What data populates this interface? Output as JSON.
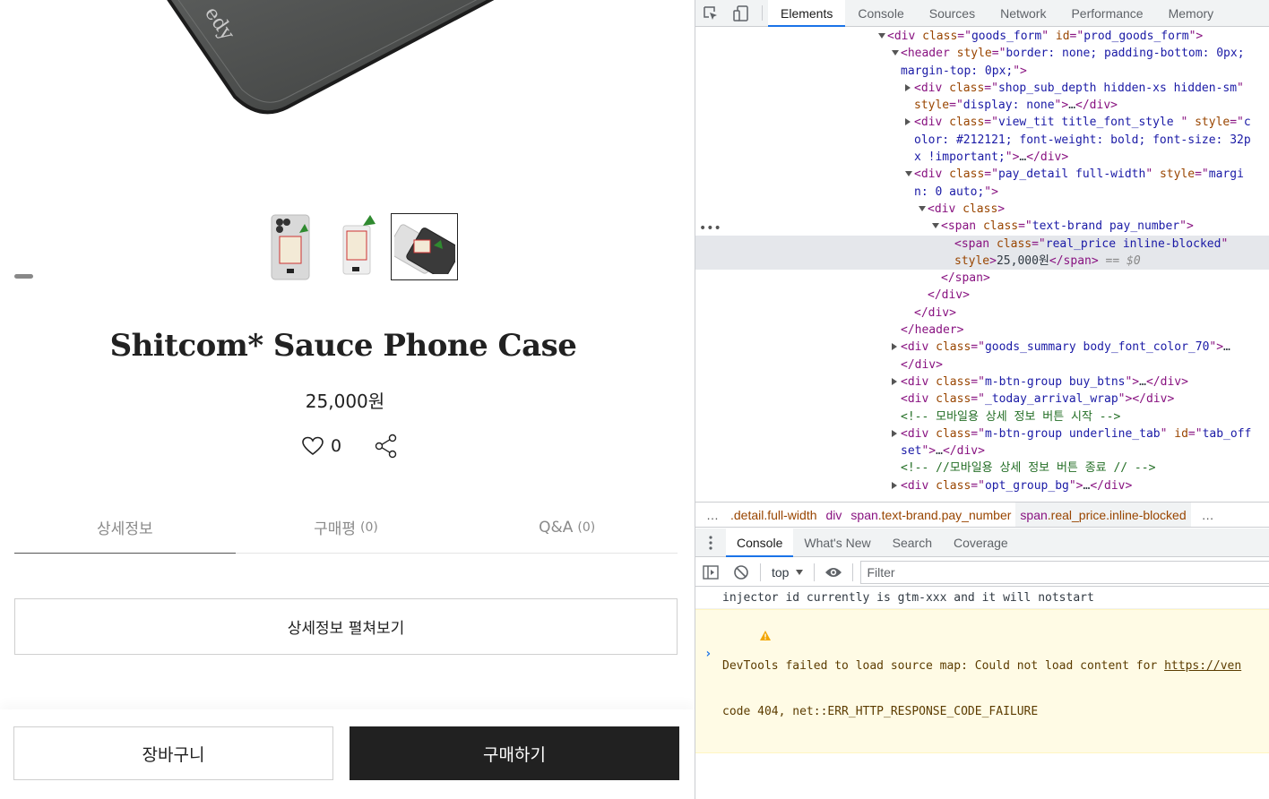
{
  "shop": {
    "hero_text": "edy",
    "thumbnails": [
      {
        "name": "thumb-case-front",
        "active": false
      },
      {
        "name": "thumb-case-back",
        "active": false
      },
      {
        "name": "thumb-case-pair",
        "active": true
      }
    ],
    "product_title": "Shitcom* Sauce Phone Case",
    "price": "25,000원",
    "like_count": "0",
    "tabs": [
      {
        "label": "상세정보",
        "count": ""
      },
      {
        "label": "구매평",
        "count": "(0)"
      },
      {
        "label": "Q&A",
        "count": "(0)"
      }
    ],
    "expand_label": "상세정보 펼쳐보기",
    "cart_label": "장바구니",
    "buy_label": "구매하기"
  },
  "devtools": {
    "tabs": [
      "Elements",
      "Console",
      "Sources",
      "Network",
      "Performance",
      "Memory"
    ],
    "active_tab": "Elements",
    "dom_lines": [
      {
        "indent": 0,
        "tw": "open",
        "parts": [
          [
            "tag",
            "<div "
          ],
          [
            "attr",
            "class"
          ],
          [
            "tag",
            "=\""
          ],
          [
            "val",
            "goods_form"
          ],
          [
            "tag",
            "\" "
          ],
          [
            "attr",
            "id"
          ],
          [
            "tag",
            "=\""
          ],
          [
            "val",
            "prod_goods_form"
          ],
          [
            "tag",
            "\">"
          ]
        ]
      },
      {
        "indent": 1,
        "tw": "open",
        "parts": [
          [
            "tag",
            "<header "
          ],
          [
            "attr",
            "style"
          ],
          [
            "tag",
            "=\""
          ],
          [
            "val",
            "border: none; padding-bottom: 0px;"
          ]
        ]
      },
      {
        "indent": 1,
        "tw": "",
        "parts": [
          [
            "val",
            "margin-top: 0px;"
          ],
          [
            "tag",
            "\">"
          ]
        ]
      },
      {
        "indent": 2,
        "tw": "closed",
        "parts": [
          [
            "tag",
            "<div "
          ],
          [
            "attr",
            "class"
          ],
          [
            "tag",
            "=\""
          ],
          [
            "val",
            "shop_sub_depth hidden-xs hidden-sm"
          ],
          [
            "tag",
            "\""
          ]
        ]
      },
      {
        "indent": 2,
        "tw": "",
        "parts": [
          [
            "attr",
            "style"
          ],
          [
            "tag",
            "=\""
          ],
          [
            "val",
            "display: none"
          ],
          [
            "tag",
            "\">"
          ],
          [
            "txt",
            "…"
          ],
          [
            "tag",
            "</div>"
          ]
        ]
      },
      {
        "indent": 2,
        "tw": "closed",
        "parts": [
          [
            "tag",
            "<div "
          ],
          [
            "attr",
            "class"
          ],
          [
            "tag",
            "=\""
          ],
          [
            "val",
            "view_tit title_font_style "
          ],
          [
            "tag",
            "\" "
          ],
          [
            "attr",
            "style"
          ],
          [
            "tag",
            "=\""
          ],
          [
            "val",
            "c"
          ]
        ]
      },
      {
        "indent": 2,
        "tw": "",
        "parts": [
          [
            "val",
            "olor: #212121; font-weight: bold; font-size: 32p"
          ]
        ]
      },
      {
        "indent": 2,
        "tw": "",
        "parts": [
          [
            "val",
            "x !important;"
          ],
          [
            "tag",
            "\">"
          ],
          [
            "txt",
            "…"
          ],
          [
            "tag",
            "</div>"
          ]
        ]
      },
      {
        "indent": 2,
        "tw": "open",
        "parts": [
          [
            "tag",
            "<div "
          ],
          [
            "attr",
            "class"
          ],
          [
            "tag",
            "=\""
          ],
          [
            "val",
            "pay_detail full-width"
          ],
          [
            "tag",
            "\" "
          ],
          [
            "attr",
            "style"
          ],
          [
            "tag",
            "=\""
          ],
          [
            "val",
            "margi"
          ]
        ]
      },
      {
        "indent": 2,
        "tw": "",
        "parts": [
          [
            "val",
            "n: 0 auto;"
          ],
          [
            "tag",
            "\">"
          ]
        ]
      },
      {
        "indent": 3,
        "tw": "open",
        "parts": [
          [
            "tag",
            "<div "
          ],
          [
            "attr",
            "class"
          ],
          [
            "tag",
            ">"
          ]
        ]
      },
      {
        "indent": 4,
        "tw": "open",
        "parts": [
          [
            "tag",
            "<span "
          ],
          [
            "attr",
            "class"
          ],
          [
            "tag",
            "=\""
          ],
          [
            "val",
            "text-brand pay_number"
          ],
          [
            "tag",
            "\">"
          ]
        ]
      },
      {
        "indent": 5,
        "tw": "",
        "sel": true,
        "parts": [
          [
            "tag",
            "<span "
          ],
          [
            "attr",
            "class"
          ],
          [
            "tag",
            "=\""
          ],
          [
            "val",
            "real_price inline-blocked"
          ],
          [
            "tag",
            "\""
          ]
        ]
      },
      {
        "indent": 5,
        "tw": "",
        "sel": true,
        "parts": [
          [
            "attr",
            "style"
          ],
          [
            "tag",
            ">"
          ],
          [
            "txt",
            "25,000원"
          ],
          [
            "tag",
            "</span>"
          ],
          [
            "dim",
            " == $0"
          ]
        ]
      },
      {
        "indent": 4,
        "tw": "",
        "parts": [
          [
            "tag",
            "</span>"
          ]
        ]
      },
      {
        "indent": 3,
        "tw": "",
        "parts": [
          [
            "tag",
            "</div>"
          ]
        ]
      },
      {
        "indent": 2,
        "tw": "",
        "parts": [
          [
            "tag",
            "</div>"
          ]
        ]
      },
      {
        "indent": 1,
        "tw": "",
        "parts": [
          [
            "tag",
            "</header>"
          ]
        ]
      },
      {
        "indent": 1,
        "tw": "closed",
        "parts": [
          [
            "tag",
            "<div "
          ],
          [
            "attr",
            "class"
          ],
          [
            "tag",
            "=\""
          ],
          [
            "val",
            "goods_summary body_font_color_70"
          ],
          [
            "tag",
            "\">"
          ],
          [
            "txt",
            "…"
          ]
        ]
      },
      {
        "indent": 1,
        "tw": "",
        "parts": [
          [
            "tag",
            "</div>"
          ]
        ]
      },
      {
        "indent": 1,
        "tw": "closed",
        "parts": [
          [
            "tag",
            "<div "
          ],
          [
            "attr",
            "class"
          ],
          [
            "tag",
            "=\""
          ],
          [
            "val",
            "m-btn-group buy_btns"
          ],
          [
            "tag",
            "\">"
          ],
          [
            "txt",
            "…"
          ],
          [
            "tag",
            "</div>"
          ]
        ]
      },
      {
        "indent": 1,
        "tw": "",
        "parts": [
          [
            "tag",
            "<div "
          ],
          [
            "attr",
            "class"
          ],
          [
            "tag",
            "=\""
          ],
          [
            "val",
            "_today_arrival_wrap"
          ],
          [
            "tag",
            "\">"
          ],
          [
            "tag",
            "</div>"
          ]
        ]
      },
      {
        "indent": 1,
        "tw": "",
        "parts": [
          [
            "cmt",
            "<!-- 모바일용 상세 정보 버튼 시작 -->"
          ]
        ]
      },
      {
        "indent": 1,
        "tw": "closed",
        "parts": [
          [
            "tag",
            "<div "
          ],
          [
            "attr",
            "class"
          ],
          [
            "tag",
            "=\""
          ],
          [
            "val",
            "m-btn-group underline_tab"
          ],
          [
            "tag",
            "\" "
          ],
          [
            "attr",
            "id"
          ],
          [
            "tag",
            "=\""
          ],
          [
            "val",
            "tab_off"
          ]
        ]
      },
      {
        "indent": 1,
        "tw": "",
        "parts": [
          [
            "val",
            "set"
          ],
          [
            "tag",
            "\">"
          ],
          [
            "txt",
            "…"
          ],
          [
            "tag",
            "</div>"
          ]
        ]
      },
      {
        "indent": 1,
        "tw": "",
        "parts": [
          [
            "cmt",
            "<!-- //모바일용 상세 정보 버튼 종료 // -->"
          ]
        ]
      },
      {
        "indent": 1,
        "tw": "closed",
        "parts": [
          [
            "tag",
            "<div "
          ],
          [
            "attr",
            "class"
          ],
          [
            "tag",
            "=\""
          ],
          [
            "val",
            "opt_group_bg"
          ],
          [
            "tag",
            "\">"
          ],
          [
            "txt",
            "…"
          ],
          [
            "tag",
            "</div>"
          ]
        ]
      }
    ],
    "breadcrumbs": [
      {
        "el": "div",
        "cls": ".detail.full-width",
        "trunc_left": true
      },
      {
        "el": "div",
        "cls": ""
      },
      {
        "el": "span",
        "cls": ".text-brand.pay_number"
      },
      {
        "el": "span",
        "cls": ".real_price.inline-blocked",
        "active": true
      }
    ],
    "drawer_tabs": [
      "Console",
      "What's New",
      "Search",
      "Coverage"
    ],
    "active_drawer_tab": "Console",
    "context": "top",
    "filter_placeholder": "Filter",
    "messages": [
      {
        "level": "info",
        "text": "injector id currently is gtm-xxx and it will notstart"
      },
      {
        "level": "warning",
        "text": "DevTools failed to load source map: Could not load content for ",
        "link": "https://ven",
        "text2": "code 404, net::ERR_HTTP_RESPONSE_CODE_FAILURE"
      }
    ],
    "prompt": "›"
  },
  "colors": {
    "brand_dark": "#212121",
    "devtools_accent": "#1a73e8",
    "tag": "#881280",
    "attr": "#994500",
    "value": "#1a1aa6",
    "comment": "#236e25",
    "warning_bg": "#fffbe5"
  }
}
